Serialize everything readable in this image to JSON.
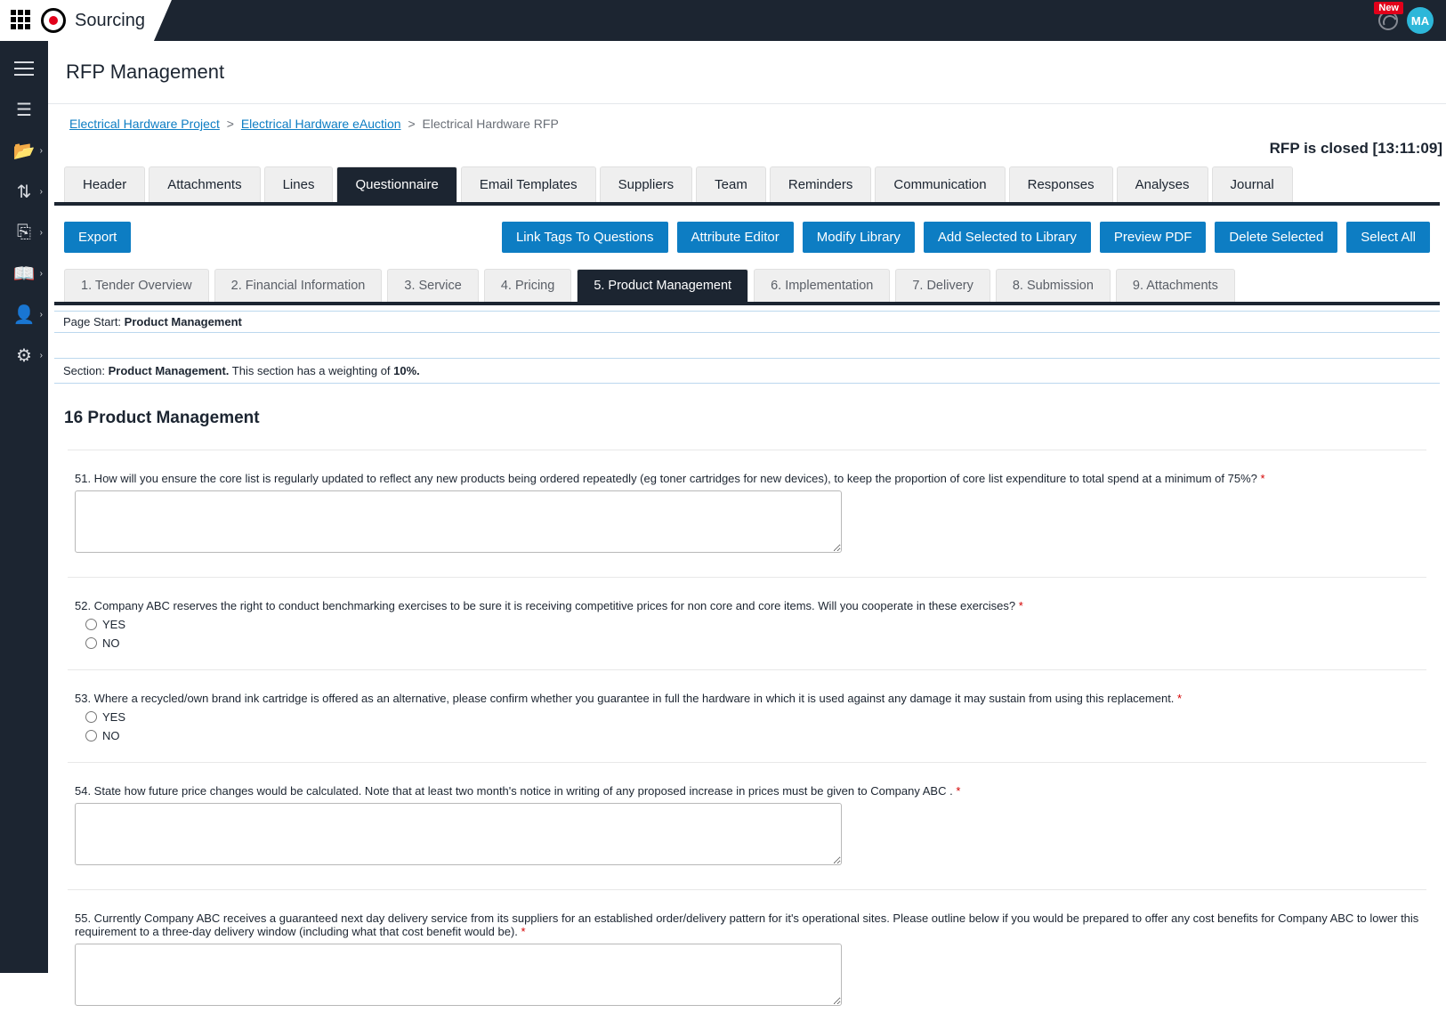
{
  "app": {
    "name": "Sourcing",
    "avatar": "MA",
    "new_badge": "New"
  },
  "page": {
    "title": "RFP Management",
    "status": "RFP is closed [13:11:09]"
  },
  "breadcrumbs": {
    "link1": "Electrical Hardware Project",
    "link2": "Electrical Hardware eAuction",
    "current": "Electrical Hardware RFP",
    "sep": ">"
  },
  "tabs_main": [
    "Header",
    "Attachments",
    "Lines",
    "Questionnaire",
    "Email Templates",
    "Suppliers",
    "Team",
    "Reminders",
    "Communication",
    "Responses",
    "Analyses",
    "Journal"
  ],
  "tabs_main_active": 3,
  "actions": {
    "export": "Export",
    "link_tags": "Link Tags To Questions",
    "attr_editor": "Attribute Editor",
    "modify_lib": "Modify Library",
    "add_selected": "Add Selected to Library",
    "preview_pdf": "Preview PDF",
    "delete_sel": "Delete Selected",
    "select_all": "Select All"
  },
  "tabs_sub": [
    "1. Tender Overview",
    "2. Financial Information",
    "3. Service",
    "4. Pricing",
    "5. Product Management",
    "6. Implementation",
    "7. Delivery",
    "8. Submission",
    "9. Attachments"
  ],
  "tabs_sub_active": 4,
  "page_start": {
    "label": "Page Start:",
    "value": "Product Management"
  },
  "section_bar": {
    "prefix": "Section: ",
    "name": "Product Management.",
    "weight_lead": " This section has a weighting of ",
    "weight": "10%."
  },
  "section_title": "16 Product Management",
  "questions": [
    {
      "num": "51.",
      "text": "How will you ensure the core list is regularly updated to reflect any new products being ordered repeatedly (eg toner cartridges for new devices), to keep the proportion of core list expenditure to total spend at a minimum of 75%? ",
      "type": "textarea"
    },
    {
      "num": "52.",
      "text": "Company ABC reserves the right to conduct benchmarking exercises to be sure it is receiving competitive prices for non core and core items. Will you cooperate in these exercises? ",
      "type": "yesno"
    },
    {
      "num": "53.",
      "text": "Where a recycled/own brand ink cartridge is offered as an alternative, please confirm whether you guarantee in full the hardware in which it is used against any damage it may sustain from using this replacement. ",
      "type": "yesno"
    },
    {
      "num": "54.",
      "text": "State how future price changes would be calculated. Note that at least two month's notice in writing of any proposed increase in prices must be given to Company ABC . ",
      "type": "textarea"
    },
    {
      "num": "55.",
      "text": "Currently Company ABC receives a guaranteed next day delivery service from its suppliers for an established order/delivery pattern for it's operational sites. Please outline below if you would be prepared to offer any cost benefits for Company ABC to lower this requirement to a three-day delivery window (including what that cost benefit would be). ",
      "type": "textarea"
    }
  ],
  "yes_label": "YES",
  "no_label": "NO",
  "req_mark": "*"
}
